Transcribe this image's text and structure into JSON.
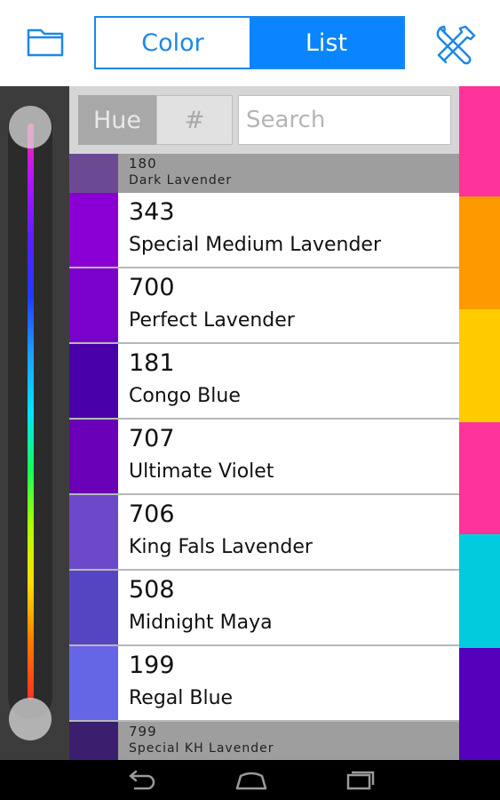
{
  "toolbar": {
    "folder_icon": "folder-icon",
    "tabs": [
      {
        "label": "Color",
        "active": false
      },
      {
        "label": "List",
        "active": true
      }
    ],
    "tools_icon": "tools-icon",
    "accent_color": "#1e88e5"
  },
  "filter": {
    "hue_label": "Hue",
    "hash_label": "#",
    "search_placeholder": "Search",
    "search_value": ""
  },
  "hue_slider": {
    "gradient_colors": [
      "#ff2d9a",
      "#b014ff",
      "#5a1fff",
      "#1f3bff",
      "#1ea0ff",
      "#00e4ff",
      "#11ff59",
      "#b0ff00",
      "#ffdd00",
      "#ff7a00",
      "#ff3020"
    ]
  },
  "colors": [
    {
      "code": "180",
      "name": "Dark Lavender",
      "swatch": "#6c4a93",
      "compact": true
    },
    {
      "code": "343",
      "name": "Special Medium Lavender",
      "swatch": "#8a00d4"
    },
    {
      "code": "700",
      "name": "Perfect Lavender",
      "swatch": "#7a00cc"
    },
    {
      "code": "181",
      "name": "Congo Blue",
      "swatch": "#4a00a8"
    },
    {
      "code": "707",
      "name": "Ultimate Violet",
      "swatch": "#6a00b8"
    },
    {
      "code": "706",
      "name": "King Fals Lavender",
      "swatch": "#6c49c9"
    },
    {
      "code": "508",
      "name": "Midnight Maya",
      "swatch": "#5645c2"
    },
    {
      "code": "199",
      "name": "Regal Blue",
      "swatch": "#6566e6"
    },
    {
      "code": "799",
      "name": "Special KH Lavender",
      "swatch": "#3b1f6e",
      "compact": true
    }
  ],
  "palette_strip": [
    "#ff3399",
    "#ff9900",
    "#ffcc00",
    "#ff3399",
    "#00ccdd",
    "#5500bb"
  ],
  "nav": {
    "back_icon": "back-icon",
    "home_icon": "home-icon",
    "recents_icon": "recents-icon"
  }
}
